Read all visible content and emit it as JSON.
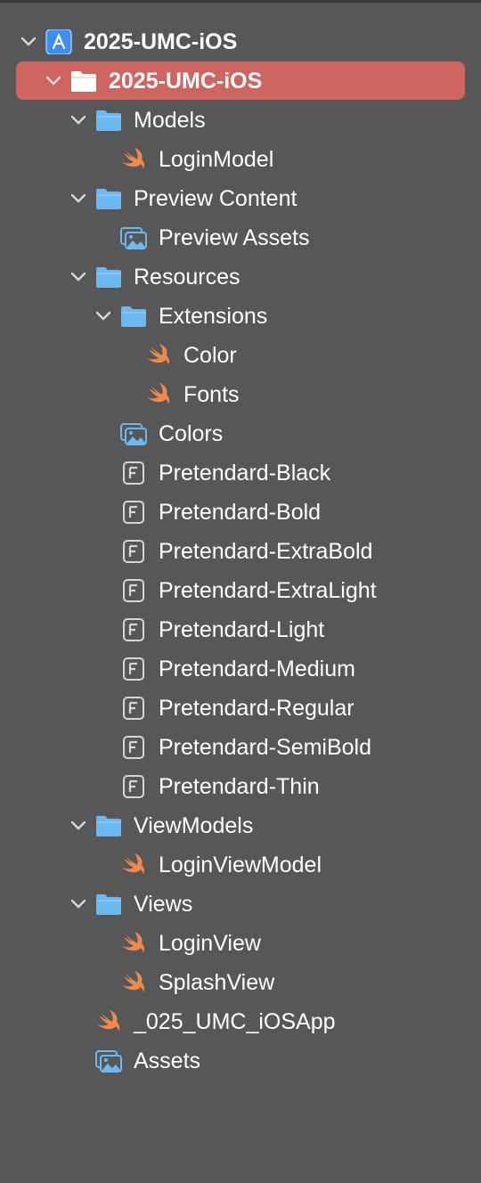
{
  "project_navigator": {
    "items": [
      {
        "label": "2025-UMC-iOS",
        "icon": "xcode-project-icon",
        "level": 0,
        "disclosure": "expanded",
        "selected": false
      },
      {
        "label": "2025-UMC-iOS",
        "icon": "folder-icon",
        "level": 1,
        "disclosure": "expanded",
        "selected": true
      },
      {
        "label": "Models",
        "icon": "folder-icon",
        "level": 2,
        "disclosure": "expanded",
        "selected": false
      },
      {
        "label": "LoginModel",
        "icon": "swift-file-icon",
        "level": 3,
        "disclosure": "none",
        "selected": false
      },
      {
        "label": "Preview Content",
        "icon": "folder-icon",
        "level": 2,
        "disclosure": "expanded",
        "selected": false
      },
      {
        "label": "Preview Assets",
        "icon": "asset-catalog-icon",
        "level": 3,
        "disclosure": "none",
        "selected": false
      },
      {
        "label": "Resources",
        "icon": "folder-icon",
        "level": 2,
        "disclosure": "expanded",
        "selected": false
      },
      {
        "label": "Extensions",
        "icon": "folder-icon",
        "level": 3,
        "disclosure": "expanded",
        "selected": false
      },
      {
        "label": "Color",
        "icon": "swift-file-icon",
        "level": 4,
        "disclosure": "none",
        "selected": false
      },
      {
        "label": "Fonts",
        "icon": "swift-file-icon",
        "level": 4,
        "disclosure": "none",
        "selected": false
      },
      {
        "label": "Colors",
        "icon": "asset-catalog-icon",
        "level": 3,
        "disclosure": "none",
        "selected": false
      },
      {
        "label": "Pretendard-Black",
        "icon": "font-file-icon",
        "level": 3,
        "disclosure": "none",
        "selected": false
      },
      {
        "label": "Pretendard-Bold",
        "icon": "font-file-icon",
        "level": 3,
        "disclosure": "none",
        "selected": false
      },
      {
        "label": "Pretendard-ExtraBold",
        "icon": "font-file-icon",
        "level": 3,
        "disclosure": "none",
        "selected": false
      },
      {
        "label": "Pretendard-ExtraLight",
        "icon": "font-file-icon",
        "level": 3,
        "disclosure": "none",
        "selected": false
      },
      {
        "label": "Pretendard-Light",
        "icon": "font-file-icon",
        "level": 3,
        "disclosure": "none",
        "selected": false
      },
      {
        "label": "Pretendard-Medium",
        "icon": "font-file-icon",
        "level": 3,
        "disclosure": "none",
        "selected": false
      },
      {
        "label": "Pretendard-Regular",
        "icon": "font-file-icon",
        "level": 3,
        "disclosure": "none",
        "selected": false
      },
      {
        "label": "Pretendard-SemiBold",
        "icon": "font-file-icon",
        "level": 3,
        "disclosure": "none",
        "selected": false
      },
      {
        "label": "Pretendard-Thin",
        "icon": "font-file-icon",
        "level": 3,
        "disclosure": "none",
        "selected": false
      },
      {
        "label": "ViewModels",
        "icon": "folder-icon",
        "level": 2,
        "disclosure": "expanded",
        "selected": false
      },
      {
        "label": "LoginViewModel",
        "icon": "swift-file-icon",
        "level": 3,
        "disclosure": "none",
        "selected": false
      },
      {
        "label": "Views",
        "icon": "folder-icon",
        "level": 2,
        "disclosure": "expanded",
        "selected": false
      },
      {
        "label": "LoginView",
        "icon": "swift-file-icon",
        "level": 3,
        "disclosure": "none",
        "selected": false
      },
      {
        "label": "SplashView",
        "icon": "swift-file-icon",
        "level": 3,
        "disclosure": "none",
        "selected": false
      },
      {
        "label": "_025_UMC_iOSApp",
        "icon": "swift-file-icon",
        "level": 2,
        "disclosure": "none",
        "selected": false
      },
      {
        "label": "Assets",
        "icon": "asset-catalog-icon",
        "level": 2,
        "disclosure": "none",
        "selected": false
      }
    ]
  },
  "colors": {
    "background": "#575757",
    "selection": "#cd6661",
    "folder": "#6cb8f0",
    "swift": "#f08a4b",
    "xcode_project": "#3d8ef0",
    "text": "#ffffff"
  }
}
